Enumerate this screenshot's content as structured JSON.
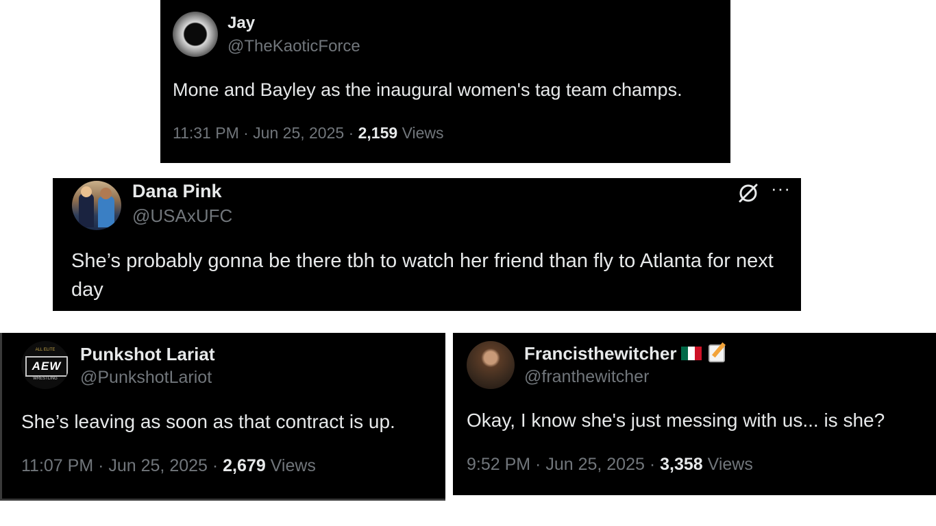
{
  "tweets": [
    {
      "name": "Jay",
      "handle": "@TheKaoticForce",
      "text": "Mone and Bayley as the inaugural women's tag team champs.",
      "time": "11:31 PM · Jun 25, 2025 · ",
      "views_count": "2,159",
      "views_label": " Views"
    },
    {
      "name": "Dana Pink",
      "handle": "@USAxUFC",
      "text": "She’s probably gonna be there tbh to watch her friend than fly to Atlanta for next day",
      "icons": [
        "no-entry-icon",
        "more-options-icon"
      ]
    },
    {
      "name": "Punkshot Lariat",
      "handle": "@PunkshotLariot",
      "text": "She’s leaving as soon as that contract is up.",
      "time": "11:07 PM · Jun 25, 2025 · ",
      "views_count": "2,679",
      "views_label": " Views",
      "avatar_logo": "AEW",
      "avatar_top": "ALL ELITE",
      "avatar_bottom": "WRESTLING"
    },
    {
      "name": "Francisthewitcher",
      "handle": "@franthewitcher",
      "text": "Okay, I know she's just messing with us... is she?",
      "time": "9:52 PM · Jun 25, 2025 · ",
      "views_count": "3,358",
      "views_label": " Views",
      "emojis": [
        "mexico-flag-icon",
        "memo-icon"
      ]
    }
  ],
  "colors": {
    "background": "#000000",
    "text": "#e7e9ea",
    "secondary": "#71767b",
    "page": "#ffffff"
  }
}
